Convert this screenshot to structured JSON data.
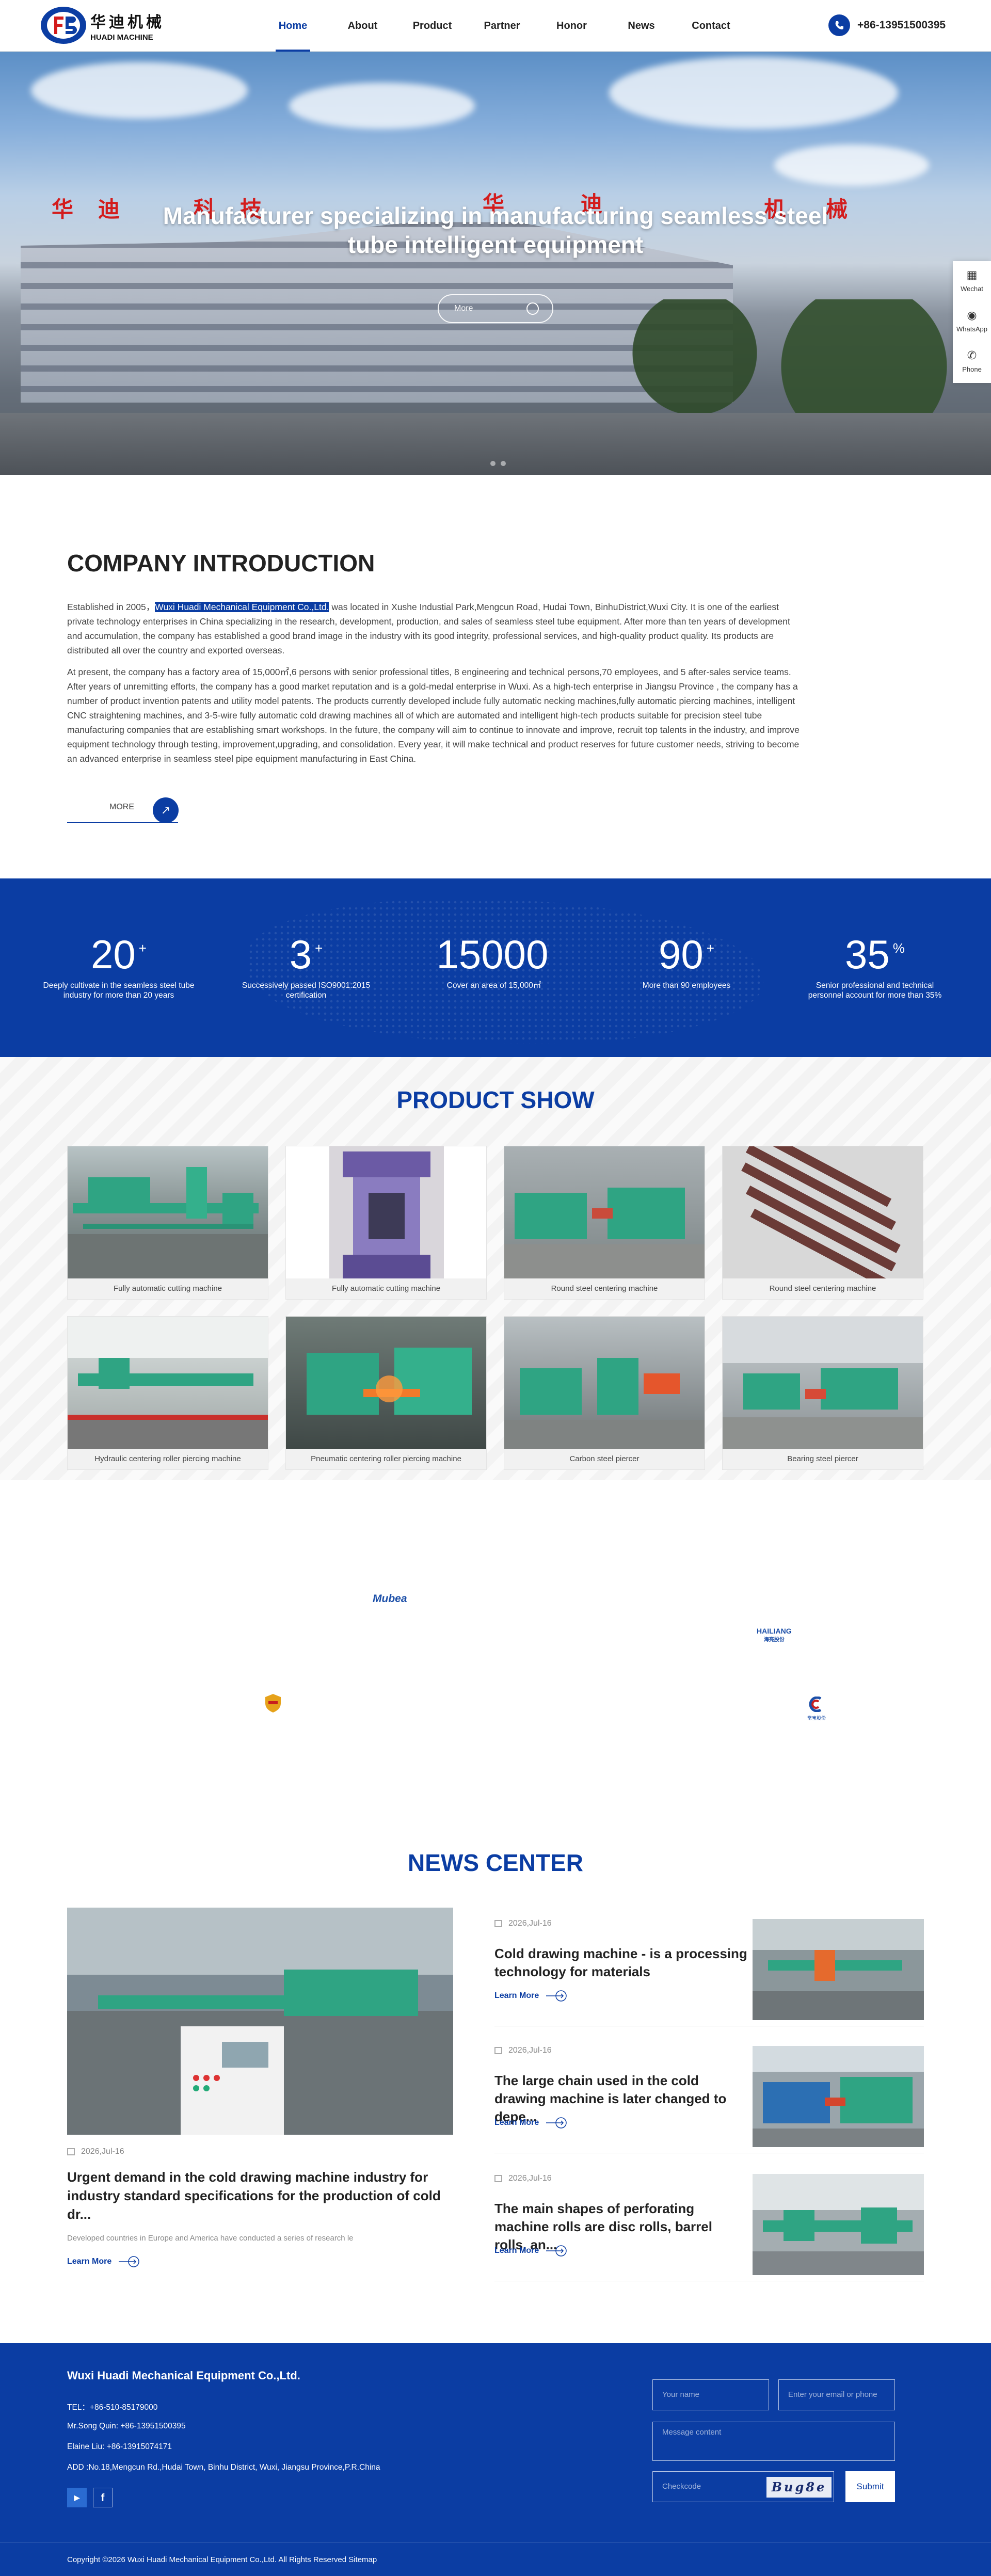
{
  "header": {
    "logo_cn": "华迪机械",
    "logo_en": "HUADI MACHINE",
    "nav": [
      "Home",
      "About",
      "Product",
      "Partner",
      "Honor",
      "News",
      "Contact"
    ],
    "phone": "+86-13951500395"
  },
  "hero": {
    "sign": [
      "华",
      "迪",
      "科",
      "技",
      "华",
      "迪",
      "机",
      "械"
    ],
    "title": "Manufacturer specializing in manufacturing seamless steel tube intelligent equipment",
    "more": "More"
  },
  "side_float": [
    "Wechat",
    "WhatsApp",
    "Phone"
  ],
  "intro": {
    "title": "COMPANY INTRODUCTION",
    "p1_pre": "Established in 2005，",
    "p1_hl": "Wuxi Huadi Mechanical Equipment Co.,Ltd.",
    "p1_post": " was located in Xushe Industial Park,Mengcun Road, Hudai Town, BinhuDistrict,Wuxi City. It is one of the earliest private technology enterprises in China specializing in the research, development, production, and sales of seamless steel tube equipment. After more than ten years of development and accumulation, the company has established a good brand image in the industry with its good integrity, professional services, and high-quality product quality. Its products are distributed all over the country and exported overseas.",
    "p2": "At present, the company has a factory area of 15,000㎡,6 persons with senior professional titles, 8 engineering and technical persons,70 employees, and 5 after-sales service teams. After years of unremitting efforts, the company has a good market reputation and is a gold-medal enterprise in Wuxi. As a high-tech enterprise in Jiangsu Province , the company has a number of product invention patents and utility model patents. The products currently developed include fully automatic necking machines,fully automatic piercing machines, intelligent CNC straightening machines, and 3-5-wire fully automatic cold drawing machines all of which are automated and intelligent high-tech products suitable for precision steel tube manufacturing companies that are establishing smart workshops. In the future, the company will aim to continue to innovate and improve, recruit top talents in the industry, and improve equipment technology through testing, improvement,upgrading, and consolidation. Every year, it will make technical and product reserves for future customer needs, striving to become an advanced enterprise in seamless steel pipe equipment manufacturing in East China.",
    "more": "MORE"
  },
  "stats": [
    {
      "num": "20",
      "suffix": "+",
      "label": "Deeply cultivate in the seamless steel tube industry for more than 20 years"
    },
    {
      "num": "3",
      "suffix": "+",
      "label": "Successively passed ISO9001:2015 certification"
    },
    {
      "num": "15000",
      "suffix": "",
      "label": "Cover an area of 15,000㎡"
    },
    {
      "num": "90",
      "suffix": "+",
      "label": "More than 90 employees"
    },
    {
      "num": "35",
      "suffix": "%",
      "label": "Senior professional and technical personnel account for more than 35%"
    }
  ],
  "products": {
    "title": "PRODUCT SHOW",
    "items": [
      "Fully automatic cutting machine",
      "Fully automatic cutting machine",
      "Round steel centering machine",
      "Round steel centering machine",
      "Hydraulic centering roller piercing machine",
      "Pneumatic centering roller piercing machine",
      "Carbon steel piercer",
      "Bearing steel piercer"
    ]
  },
  "partners": {
    "mubea": "Mubea",
    "hailiang": "HAILIANG",
    "hailiang_cn": "海亮股份",
    "c_cn": "常宝股份"
  },
  "news": {
    "title": "NEWS CENTER",
    "main": {
      "date": "2026,Jul-16",
      "title": "Urgent demand in the cold drawing machine industry for industry standard specifications for the production of cold dr...",
      "desc": "Developed countries in Europe and America have conducted a series of research le",
      "learn": "Learn More"
    },
    "items": [
      {
        "date": "2026,Jul-16",
        "title": "Cold drawing machine - is a processing technology for materials",
        "learn": "Learn More"
      },
      {
        "date": "2026,Jul-16",
        "title": "The large chain used in the cold drawing machine is later changed to depe...",
        "learn": "Learn More"
      },
      {
        "date": "2026,Jul-16",
        "title": "The main shapes of perforating machine rolls are disc rolls, barrel rolls, an...",
        "learn": "Learn More"
      }
    ]
  },
  "footer": {
    "company": "Wuxi Huadi Mechanical Equipment Co.,Ltd.",
    "tel": "TEL：+86-510-85179000",
    "contact1": "Mr.Song Quin: +86-13951500395",
    "contact2": "Elaine Liu: +86-13915074171",
    "addr": "ADD :No.18,Mengcun Rd.,Hudai Town, Binhu District, Wuxi, Jiangsu Province,P.R.China",
    "form": {
      "name": "Your name",
      "email": "Enter your email or phone",
      "message": "Message content",
      "checkcode": "Checkcode",
      "captcha": "Bug8e",
      "submit": "Submit"
    },
    "copyright": "Copyright ©2026 Wuxi Huadi Mechanical Equipment Co.,Ltd. All Rights Reserved Sitemap"
  },
  "colors": {
    "brand": "#0b3da3",
    "accent_red": "#d31c1c",
    "machine_green": "#2fa483"
  }
}
